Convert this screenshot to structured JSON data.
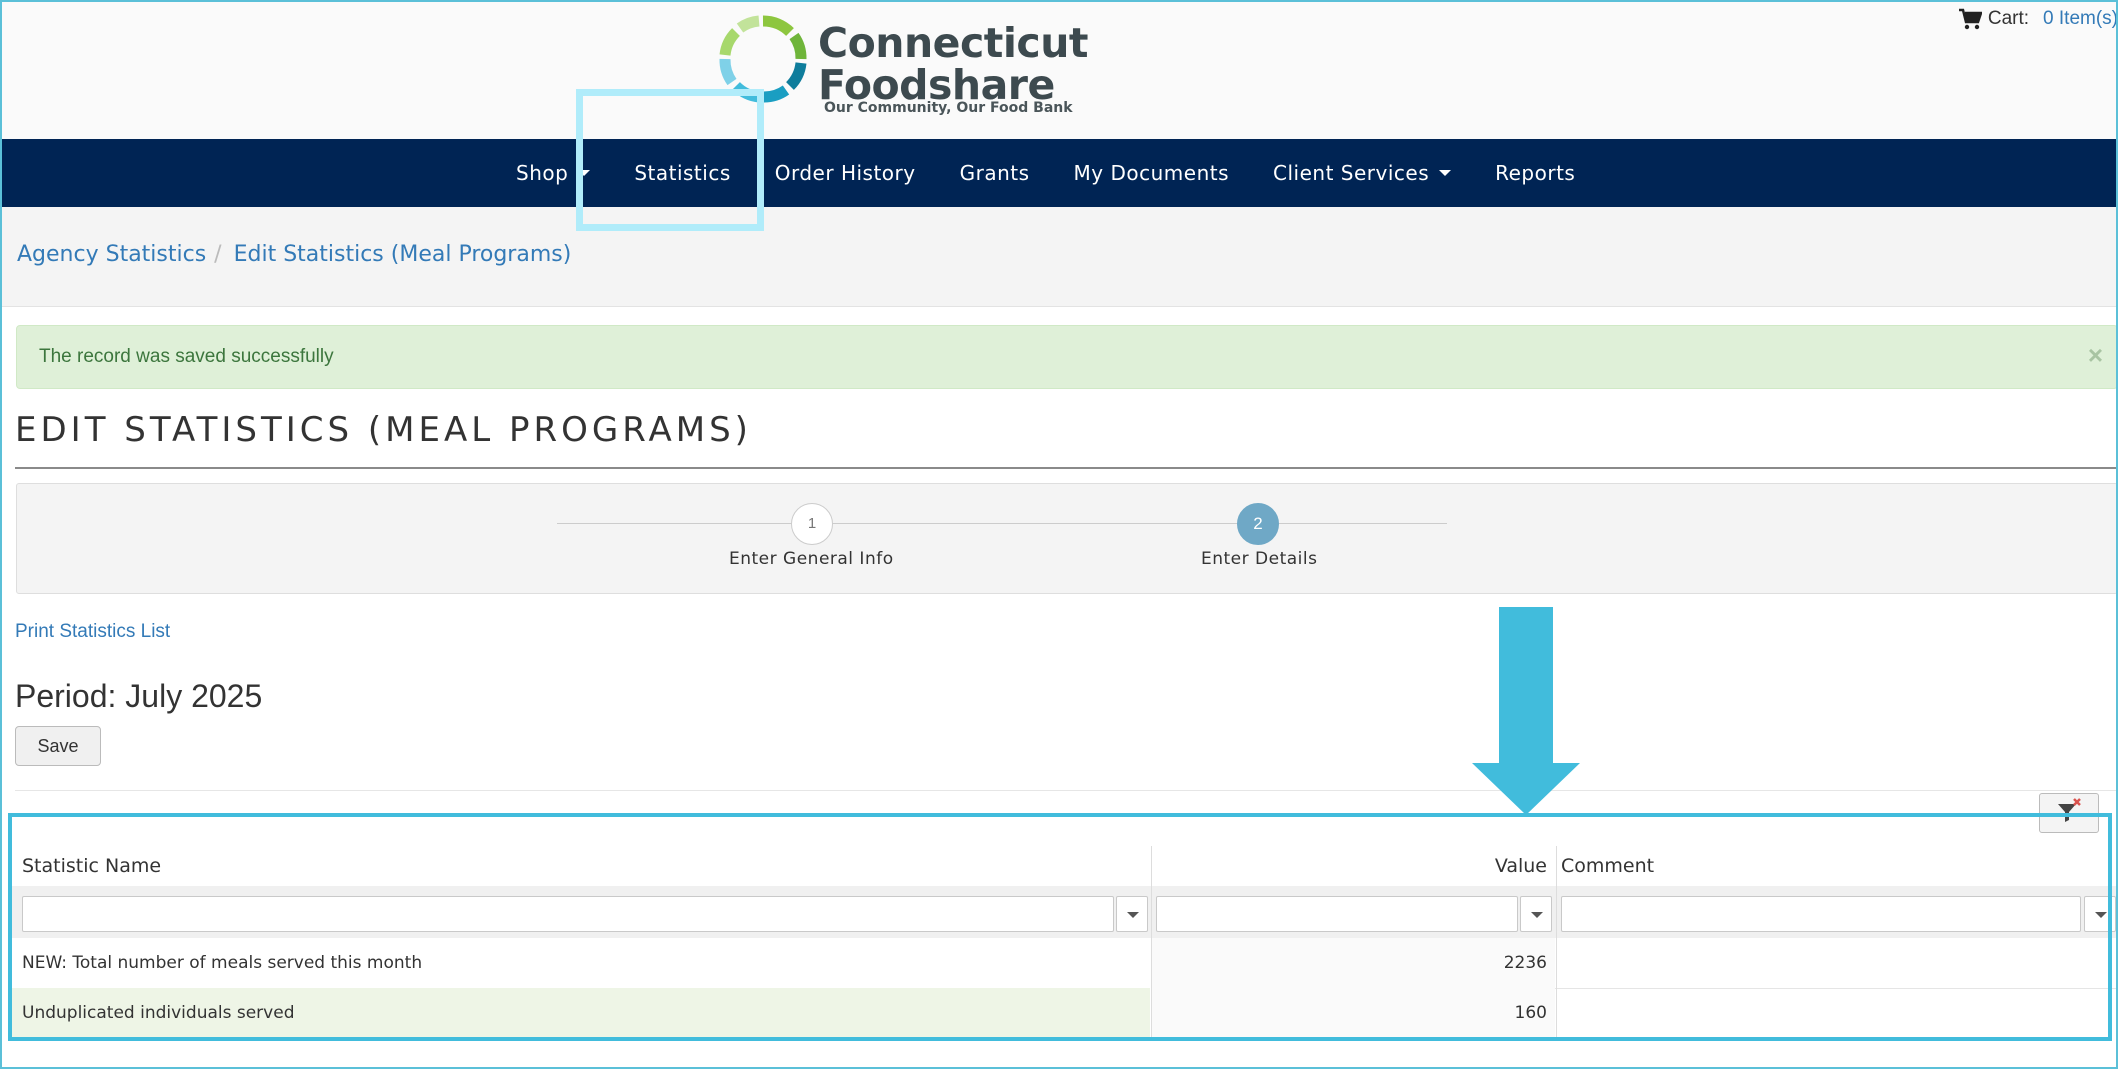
{
  "header": {
    "logo_title": "Connecticut Foodshare",
    "logo_line1": "Connecticut",
    "logo_line2": "Foodshare",
    "logo_tagline": "Our Community, Our Food Bank",
    "cart_label": "Cart:",
    "cart_count": "0 Item(s)",
    "brand_colors": [
      "#8dc63f",
      "#41bcdc",
      "#0f7d9c",
      "#3d4a4f"
    ]
  },
  "nav": {
    "items": [
      {
        "label": "Shop",
        "dropdown": true
      },
      {
        "label": "Statistics",
        "dropdown": false
      },
      {
        "label": "Order History",
        "dropdown": false
      },
      {
        "label": "Grants",
        "dropdown": false
      },
      {
        "label": "My Documents",
        "dropdown": false
      },
      {
        "label": "Client Services",
        "dropdown": true
      },
      {
        "label": "Reports",
        "dropdown": false
      }
    ],
    "background": "#002454"
  },
  "breadcrumb": {
    "items": [
      "Agency Statistics",
      "Edit Statistics (Meal Programs)"
    ],
    "separator": "/"
  },
  "alert": {
    "message": "The record was saved successfully",
    "close": "×"
  },
  "page": {
    "title": "EDIT STATISTICS (MEAL PROGRAMS)",
    "print_link": "Print Statistics List",
    "period": "Period: July 2025",
    "save_label": "Save"
  },
  "wizard": {
    "steps": [
      {
        "number": "1",
        "label": "Enter General Info",
        "active": false
      },
      {
        "number": "2",
        "label": "Enter Details",
        "active": true
      }
    ]
  },
  "grid": {
    "columns": [
      "Statistic Name",
      "Value",
      "Comment"
    ],
    "rows": [
      {
        "name": "NEW: Total number of meals served this month",
        "value": "2236",
        "comment": ""
      },
      {
        "name": "Unduplicated individuals served",
        "value": "160",
        "comment": ""
      }
    ]
  },
  "annotations": {
    "highlight_color": "#b0ecfa",
    "arrow_color": "#41bcdc"
  }
}
